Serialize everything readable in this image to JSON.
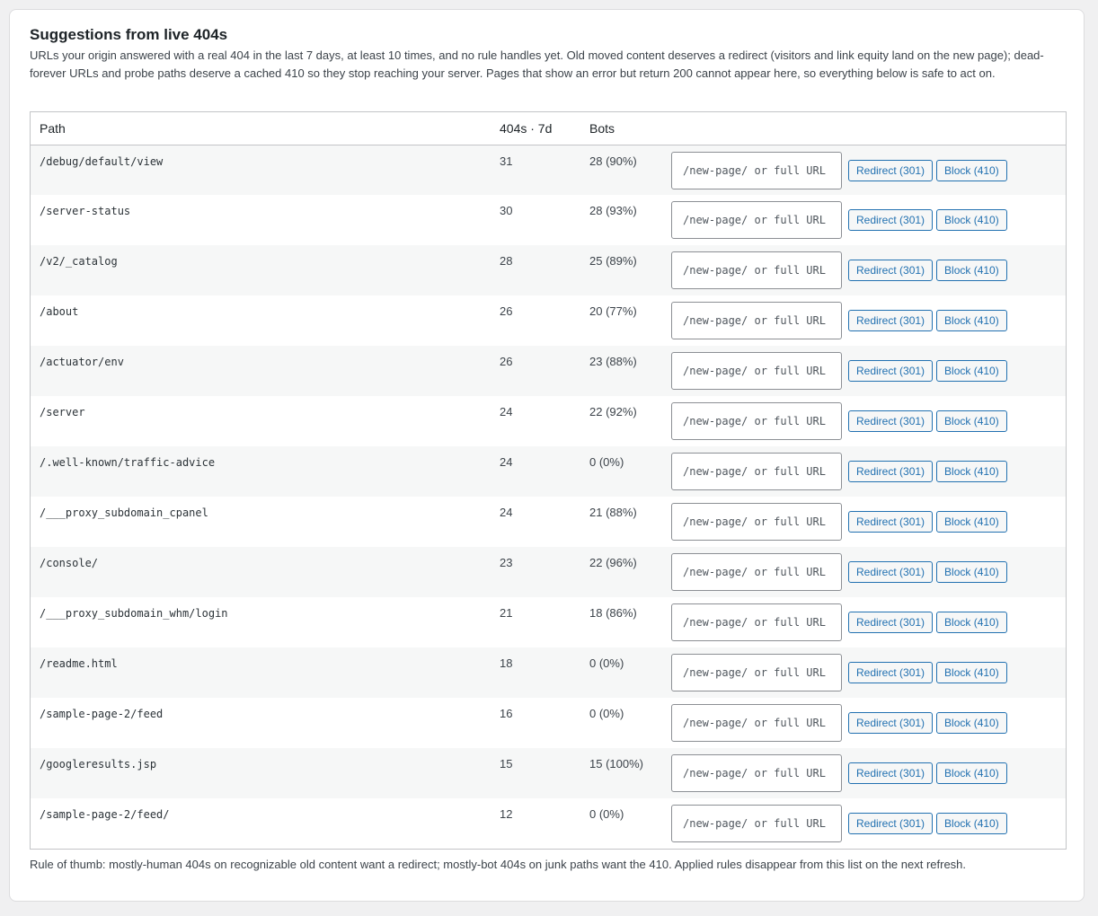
{
  "title": "Suggestions from live 404s",
  "description": "URLs your origin answered with a real 404 in the last 7 days, at least 10 times, and no rule handles yet. Old moved content deserves a redirect (visitors and link equity land on the new page); dead-forever URLs and probe paths deserve a cached 410 so they stop reaching your server. Pages that show an error but return 200 cannot appear here, so everything below is safe to act on.",
  "columns": {
    "path": "Path",
    "count": "404s · 7d",
    "bots": "Bots"
  },
  "input_placeholder": "/new-page/ or full URL",
  "redirect_label": "Redirect (301)",
  "block_label": "Block (410)",
  "rows": [
    {
      "path": "/debug/default/view",
      "count": "31",
      "bots": "28 (90%)"
    },
    {
      "path": "/server-status",
      "count": "30",
      "bots": "28 (93%)"
    },
    {
      "path": "/v2/_catalog",
      "count": "28",
      "bots": "25 (89%)"
    },
    {
      "path": "/about",
      "count": "26",
      "bots": "20 (77%)"
    },
    {
      "path": "/actuator/env",
      "count": "26",
      "bots": "23 (88%)"
    },
    {
      "path": "/server",
      "count": "24",
      "bots": "22 (92%)"
    },
    {
      "path": "/.well-known/traffic-advice",
      "count": "24",
      "bots": "0 (0%)"
    },
    {
      "path": "/___proxy_subdomain_cpanel",
      "count": "24",
      "bots": "21 (88%)"
    },
    {
      "path": "/console/",
      "count": "23",
      "bots": "22 (96%)"
    },
    {
      "path": "/___proxy_subdomain_whm/login",
      "count": "21",
      "bots": "18 (86%)"
    },
    {
      "path": "/readme.html",
      "count": "18",
      "bots": "0 (0%)"
    },
    {
      "path": "/sample-page-2/feed",
      "count": "16",
      "bots": "0 (0%)"
    },
    {
      "path": "/googleresults.jsp",
      "count": "15",
      "bots": "15 (100%)"
    },
    {
      "path": "/sample-page-2/feed/",
      "count": "12",
      "bots": "0 (0%)"
    }
  ],
  "footnote": "Rule of thumb: mostly-human 404s on recognizable old content want a redirect; mostly-bot 404s on junk paths want the 410. Applied rules disappear from this list on the next refresh."
}
